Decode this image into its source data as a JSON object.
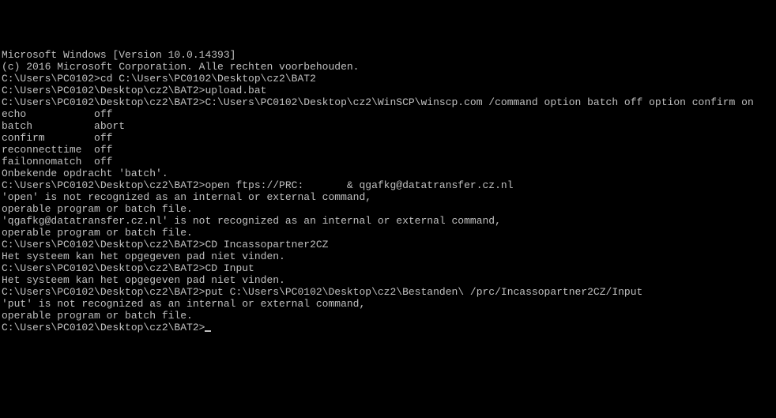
{
  "lines": {
    "l1": "Microsoft Windows [Version 10.0.14393]",
    "l2": "(c) 2016 Microsoft Corporation. Alle rechten voorbehouden.",
    "l3": "",
    "l4": "C:\\Users\\PC0102>cd C:\\Users\\PC0102\\Desktop\\cz2\\BAT2",
    "l5": "",
    "l6": "C:\\Users\\PC0102\\Desktop\\cz2\\BAT2>upload.bat",
    "l7": "",
    "l8": "C:\\Users\\PC0102\\Desktop\\cz2\\BAT2>C:\\Users\\PC0102\\Desktop\\cz2\\WinSCP\\winscp.com /command option batch off option confirm on",
    "l9": "echo           off",
    "l10": "batch          abort",
    "l11": "confirm        off",
    "l12": "reconnecttime  off",
    "l13": "failonnomatch  off",
    "l14": "Onbekende opdracht 'batch'.",
    "l15": "",
    "l16": "C:\\Users\\PC0102\\Desktop\\cz2\\BAT2>open ftps://PRC:       & qgafkg@datatransfer.cz.nl",
    "l17": "'open' is not recognized as an internal or external command,",
    "l18": "operable program or batch file.",
    "l19": "'qgafkg@datatransfer.cz.nl' is not recognized as an internal or external command,",
    "l20": "operable program or batch file.",
    "l21": "",
    "l22": "C:\\Users\\PC0102\\Desktop\\cz2\\BAT2>CD Incassopartner2CZ",
    "l23": "Het systeem kan het opgegeven pad niet vinden.",
    "l24": "",
    "l25": "C:\\Users\\PC0102\\Desktop\\cz2\\BAT2>CD Input",
    "l26": "Het systeem kan het opgegeven pad niet vinden.",
    "l27": "",
    "l28": "C:\\Users\\PC0102\\Desktop\\cz2\\BAT2>put C:\\Users\\PC0102\\Desktop\\cz2\\Bestanden\\ /prc/Incassopartner2CZ/Input",
    "l29": "'put' is not recognized as an internal or external command,",
    "l30": "operable program or batch file.",
    "l31": "",
    "l32": "C:\\Users\\PC0102\\Desktop\\cz2\\BAT2>"
  }
}
